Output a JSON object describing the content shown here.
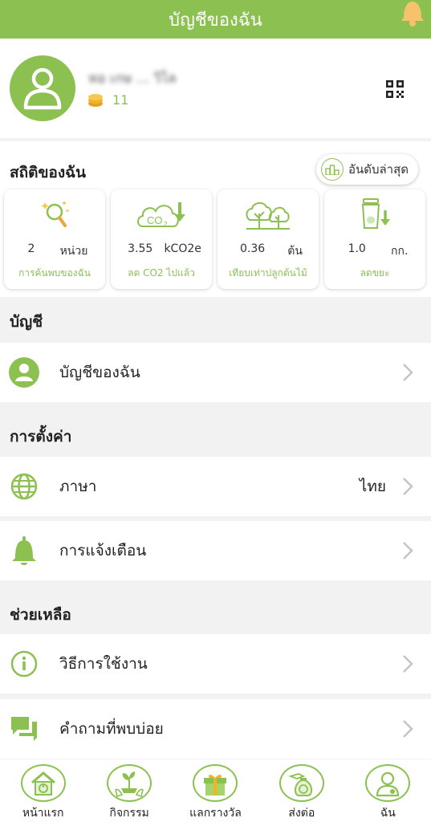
{
  "header": {
    "title": "บัญชีของฉัน"
  },
  "profile": {
    "username": "หอ เกษ ... วิไล",
    "coins": "11"
  },
  "stats": {
    "title": "สถิติของฉัน",
    "rank_label": "อันดับล่าสุด",
    "cards": [
      {
        "value": "2",
        "unit": "หน่วย",
        "label": "การค้นพบของฉัน",
        "icon": "magnifier-sparkle-icon"
      },
      {
        "value": "3.55",
        "unit": "kCO2e",
        "label": "ลด CO2 ไปแล้ว",
        "icon": "co2-cloud-icon"
      },
      {
        "value": "0.36",
        "unit": "ต้น",
        "label": "เทียบเท่าปลูกต้นไม้",
        "icon": "trees-icon"
      },
      {
        "value": "1.0",
        "unit": "กก.",
        "label": "ลดขยะ",
        "icon": "waste-bin-icon"
      }
    ]
  },
  "account": {
    "title": "บัญชี",
    "my_account": "บัญชีของฉัน"
  },
  "settings": {
    "title": "การตั้งค่า",
    "language_label": "ภาษา",
    "language_value": "ไทย",
    "notifications_label": "การแจ้งเตือน"
  },
  "help": {
    "title": "ช่วยเหลือ",
    "howto_label": "วิธีการใช้งาน",
    "faq_label": "คำถามที่พบบ่อย"
  },
  "tabs": [
    {
      "label": "หน้าแรก",
      "icon": "home-icon"
    },
    {
      "label": "กิจกรรม",
      "icon": "plant-icon"
    },
    {
      "label": "แลกรางวัล",
      "icon": "gift-icon"
    },
    {
      "label": "ส่งต่อ",
      "icon": "money-bag-icon"
    },
    {
      "label": "ฉัน",
      "icon": "user-icon"
    }
  ],
  "colors": {
    "accent": "#8cc152",
    "background": "#f2f2f2",
    "coin": "#f0b429"
  }
}
